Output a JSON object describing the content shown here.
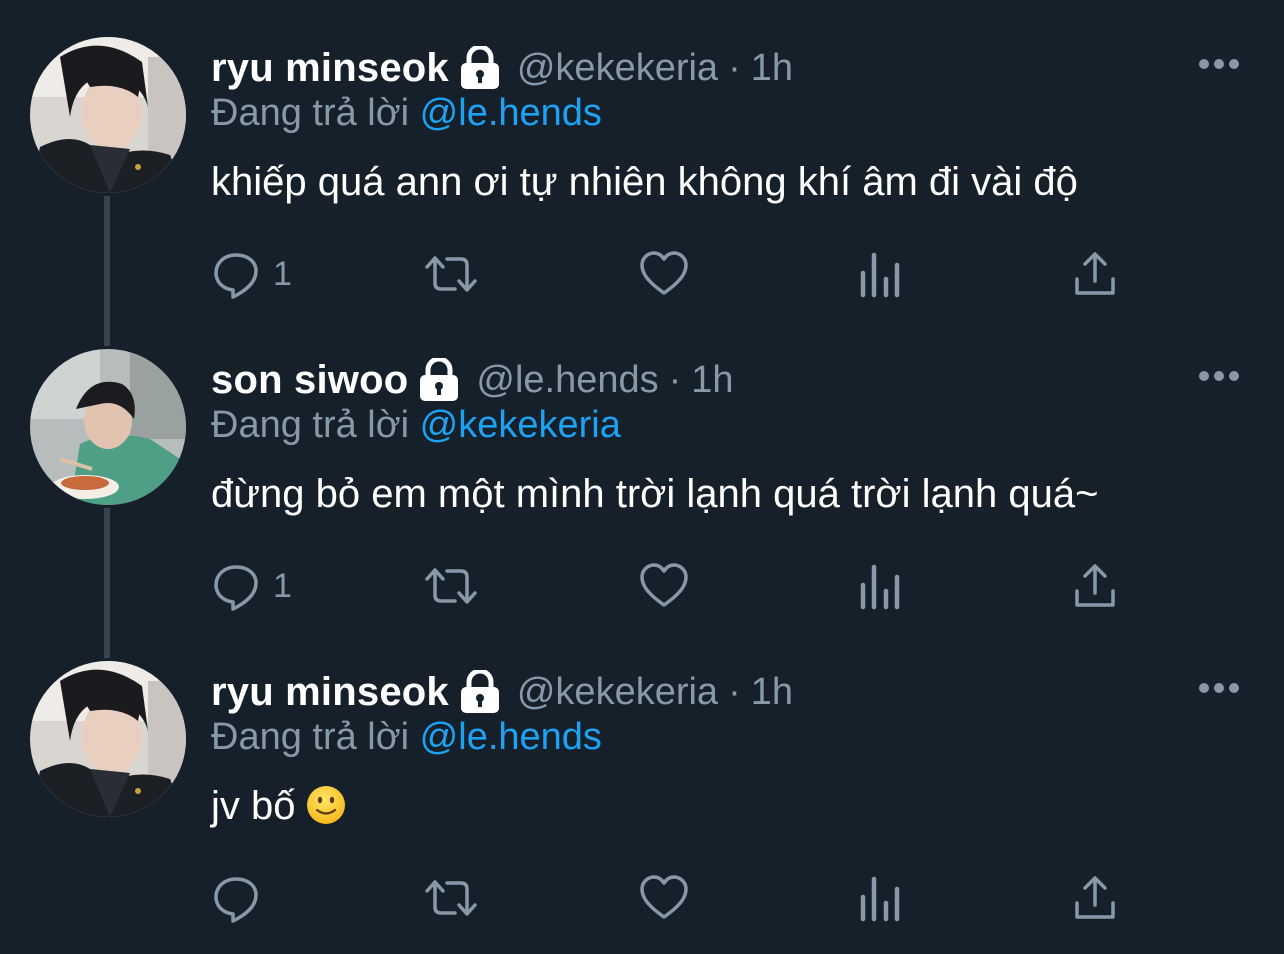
{
  "tweets": [
    {
      "name": "ryu minseok",
      "handle": "@kekekeria",
      "dot": "·",
      "time": "1h",
      "reply_prefix": "Đang trả lời",
      "reply_to": "@le.hends",
      "text": "khiếp quá ann ơi tự nhiên không khí âm đi vài độ",
      "reply_count": "1",
      "has_emoji": false
    },
    {
      "name": "son siwoo",
      "handle": "@le.hends",
      "dot": "·",
      "time": "1h",
      "reply_prefix": "Đang trả lời",
      "reply_to": "@kekekeria",
      "text": "đừng bỏ em một mình trời lạnh quá trời lạnh quá~",
      "reply_count": "1",
      "has_emoji": false
    },
    {
      "name": "ryu minseok",
      "handle": "@kekekeria",
      "dot": "·",
      "time": "1h",
      "reply_prefix": "Đang trả lời",
      "reply_to": "@le.hends",
      "text": "jv bố",
      "reply_count": "",
      "has_emoji": true,
      "emoji": "slightly-smiling-face"
    }
  ],
  "icons": {
    "protected": "lock-icon",
    "more": "more-icon",
    "reply": "reply-icon",
    "retweet": "retweet-icon",
    "like": "like-icon",
    "analytics": "analytics-icon",
    "share": "share-icon"
  },
  "colors": {
    "background": "#15202b",
    "name": "#ffffff",
    "secondary": "#8899a6",
    "link": "#1da1f2",
    "thread_line": "#38444d"
  }
}
